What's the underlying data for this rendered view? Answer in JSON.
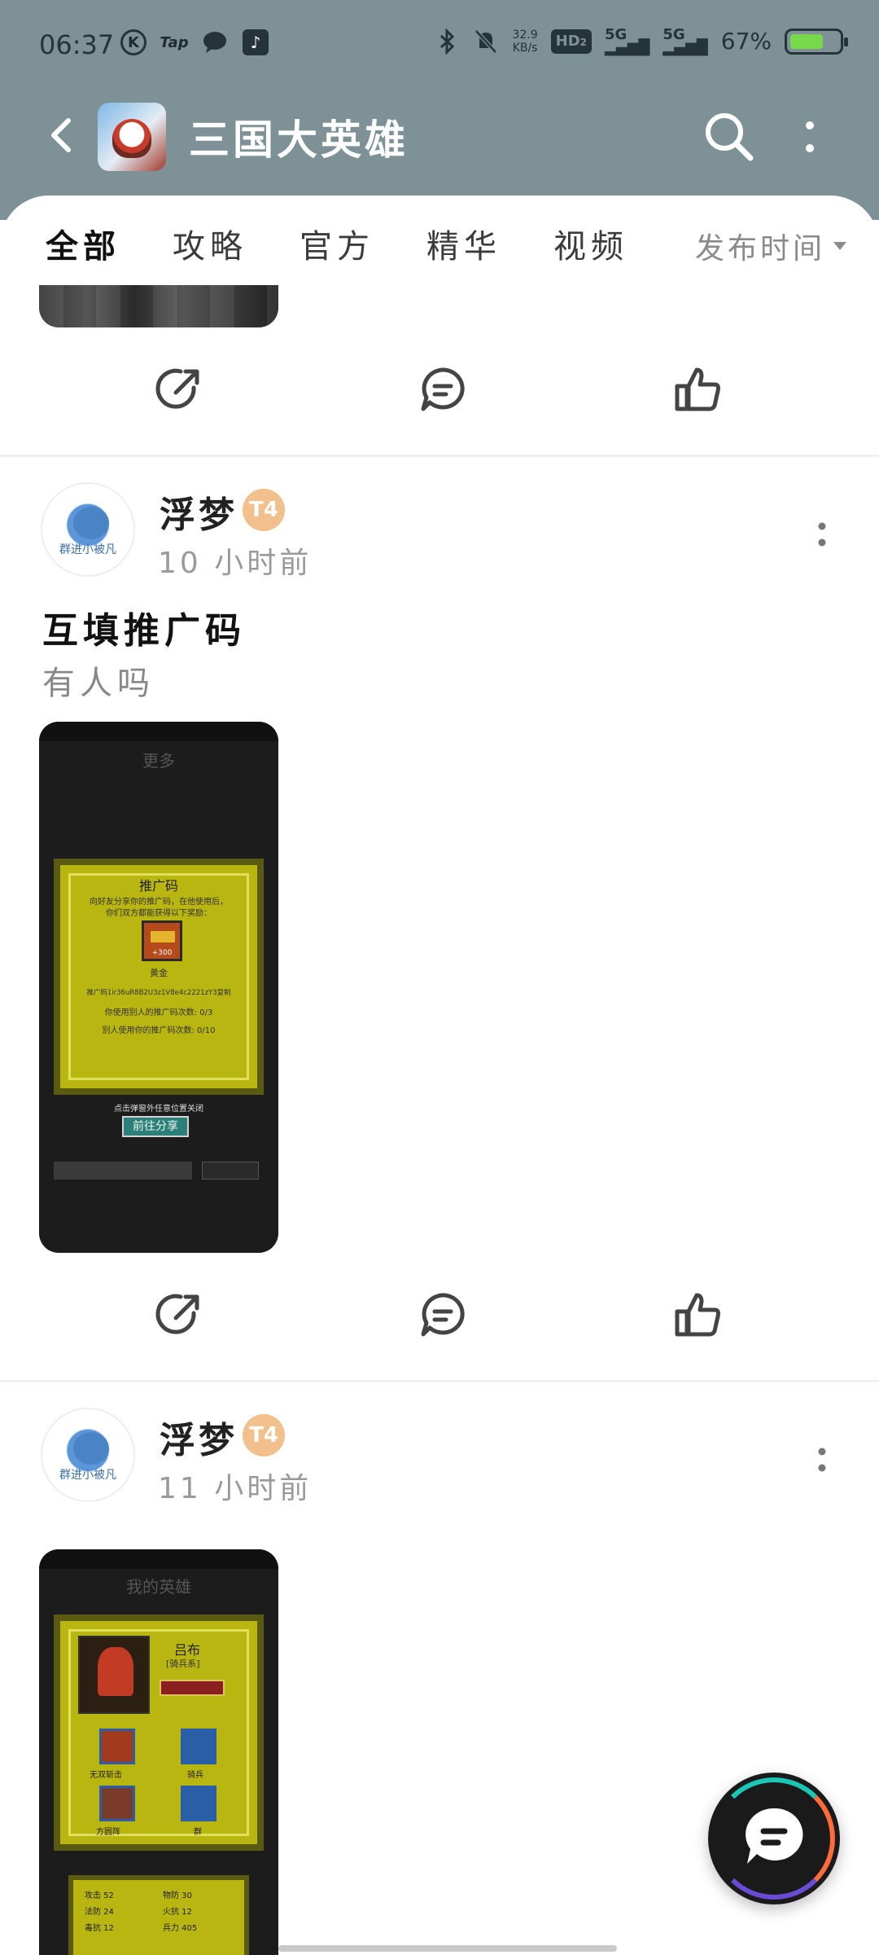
{
  "status_bar": {
    "time": "06:37",
    "left_icons": [
      "k-icon",
      "tap-icon",
      "chat-icon",
      "tiktok-icon"
    ],
    "speed_value": "32.9",
    "speed_unit": "KB/s",
    "hd_label": "HD",
    "hd_sub": "2",
    "net1": "5G",
    "net2": "5G",
    "battery_text": "67%",
    "battery_level": 0.67
  },
  "header": {
    "title": "三国大英雄"
  },
  "tabs": [
    {
      "label": "全部",
      "active": true
    },
    {
      "label": "攻略",
      "active": false
    },
    {
      "label": "官方",
      "active": false
    },
    {
      "label": "精华",
      "active": false
    },
    {
      "label": "视频",
      "active": false
    }
  ],
  "sort_label": "发布时间",
  "posts": [
    {
      "username": "浮梦",
      "avatar_text": "群进小被凡",
      "badge": "T4",
      "time": "10 小时前",
      "title": "互填推广码",
      "body": "有人吗",
      "shot": {
        "header": "更多",
        "panel_title": "推广码",
        "panel_line1": "向好友分享你的推广码，在他使用后，",
        "panel_line2": "你们双方都能获得以下奖励：",
        "reward_qty": "+300",
        "reward_name": "黄金",
        "code_line": "推广码1ir36uR8B2U3z1V8e4c2221zY3复制",
        "used_line1": "你使用别人的推广码次数: 0/3",
        "used_line2": "别人使用你的推广码次数: 0/10",
        "hint": "点击弹窗外任意位置关闭",
        "share_btn": "前往分享"
      }
    },
    {
      "username": "浮梦",
      "avatar_text": "群进小被凡",
      "badge": "T4",
      "time": "11 小时前",
      "shot": {
        "header": "我的英雄",
        "hero_name": "吕布",
        "hero_type": "[骑兵系]",
        "tag1": "无双斩击",
        "tag2": "骑兵",
        "tag3": "方圆阵",
        "tag4": "群",
        "stats": [
          "攻击 52",
          "物防 30",
          "法防 24",
          "火抗 12",
          "毒抗 12",
          "兵力 405"
        ]
      }
    }
  ]
}
